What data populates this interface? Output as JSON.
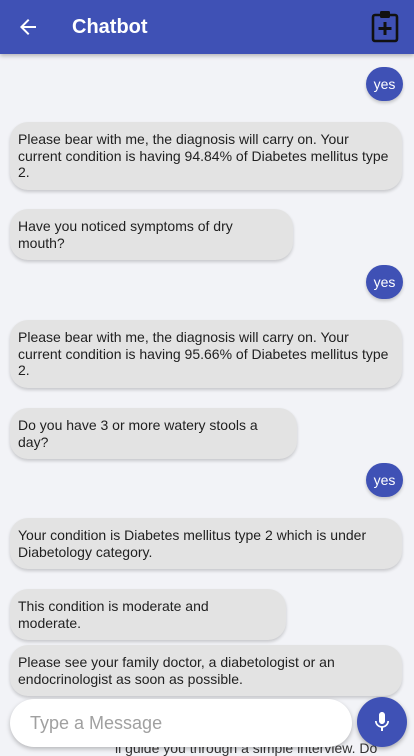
{
  "app": {
    "title": "Chatbot"
  },
  "icons": {
    "back": "arrow-back-icon",
    "clipboard": "clipboard-plus-icon",
    "mic": "mic-icon"
  },
  "colors": {
    "primary": "#3f51b5",
    "bot_bubble": "#e3e3e3",
    "background": "#f2f3f7"
  },
  "messages": [
    {
      "sender": "user",
      "text": "yes"
    },
    {
      "sender": "bot",
      "text": "Please bear with me, the diagnosis will carry on. Your current condition is having 94.84% of Diabetes mellitus type 2."
    },
    {
      "sender": "bot",
      "text": "Have you noticed symptoms of dry mouth?"
    },
    {
      "sender": "user",
      "text": "yes"
    },
    {
      "sender": "bot",
      "text": "Please bear with me, the diagnosis will carry on. Your current condition is having 95.66% of Diabetes mellitus type 2."
    },
    {
      "sender": "bot",
      "text": "Do you have 3 or more watery stools a day?"
    },
    {
      "sender": "user",
      "text": "yes"
    },
    {
      "sender": "bot",
      "text": "Your condition is Diabetes mellitus type 2 which is under Diabetology category."
    },
    {
      "sender": "bot",
      "text": "This condition is moderate and moderate."
    },
    {
      "sender": "bot",
      "text": "Please see your family doctor, a diabetologist or an endocrinologist as soon as possible."
    }
  ],
  "partial_text": "ll guide you through a simple interview. Do",
  "composer": {
    "placeholder": "Type a Message"
  }
}
